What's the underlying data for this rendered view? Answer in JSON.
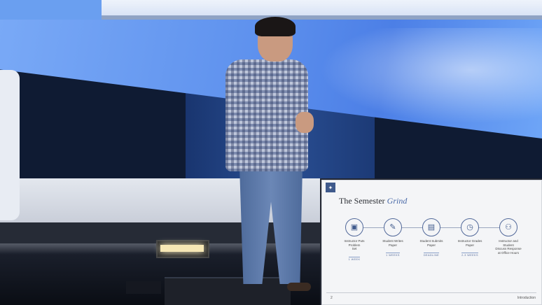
{
  "slide": {
    "logo_icon": "logo-icon",
    "title_main": "The Semester",
    "title_accent": "Grind",
    "steps": [
      {
        "icon": "presenter-icon",
        "text": "Instructor Puts\nProblem\nSet",
        "tag": "1 WEEK"
      },
      {
        "icon": "pencil-icon",
        "text": "Student Writes\nPaper",
        "tag": "1 WEEKS"
      },
      {
        "icon": "document-icon",
        "text": "Student Submits\nPaper",
        "tag": "DEADLINE"
      },
      {
        "icon": "clock-icon",
        "text": "Instructor Grades\nPaper",
        "tag": "2-3 WEEKS"
      },
      {
        "icon": "people-icon",
        "text": "Instructor and\nStudent\nDiscuss Response\nat Office Hours",
        "tag": ""
      }
    ],
    "page_number": "2",
    "section": "Introduction"
  }
}
